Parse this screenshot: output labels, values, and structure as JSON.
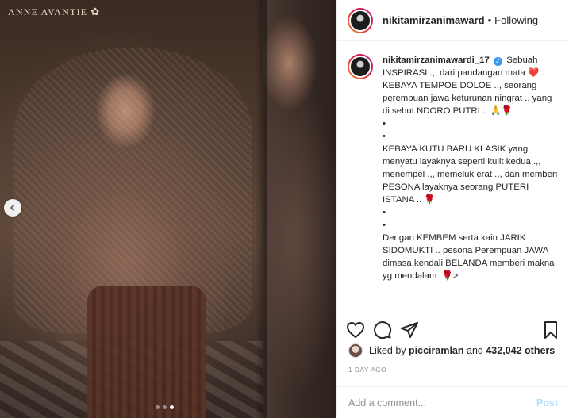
{
  "media": {
    "watermark": "ANNE AVANTIE",
    "watermark_icon": "lotus-flower-icon",
    "carousel": {
      "slide_count": 3,
      "active_index": 2
    }
  },
  "header": {
    "username": "nikitamirzanimaward",
    "separator": "•",
    "follow_label": "Following"
  },
  "caption": {
    "username": "nikitamirzanimawardi_17",
    "verified": true,
    "lines": [
      "Sebuah INSPIRASI .,, dari pandangan mata ❤️.. KEBAYA TEMPOE DOLOE .,, seorang perempuan jawa keturunan ningrat .. yang di sebut NDORO PUTRI .. 🙏🌹",
      "•",
      "•",
      "KEBAYA KUTU BARU KLASIK yang menyatu layaknya seperti kulit kedua .,, menempel .,, memeluk erat .,, dan memberi PESONA layaknya seorang PUTERI ISTANA .. 🌹",
      "•",
      "•",
      "Dengan KEMBEM serta kain JARIK SIDOMUKTI .. pesona Perempuan JAWA dimasa kendali BELANDA memberi makna yg mendalam .🌹>"
    ]
  },
  "likes": {
    "prefix": "Liked by",
    "user": "picciramlan",
    "conjunction": "and",
    "count_text": "432,042 others"
  },
  "timestamp": "1 DAY AGO",
  "comment": {
    "placeholder": "Add a comment...",
    "post_label": "Post"
  }
}
